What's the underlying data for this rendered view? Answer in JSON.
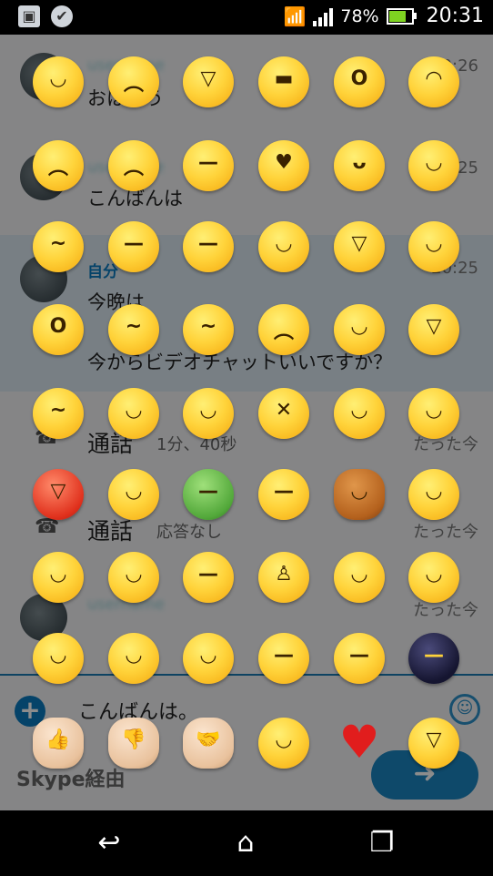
{
  "status_bar": {
    "battery_percent": "78%",
    "battery_level": 0.78,
    "time": "20:31",
    "icons": [
      "image-icon",
      "check-shield-icon",
      "wifi-icon",
      "signal-icon",
      "battery-icon"
    ]
  },
  "chat": {
    "messages": [
      {
        "sender": "",
        "time": "20:26",
        "text": "おはよう"
      },
      {
        "sender": "",
        "time": "20:25",
        "text": "こんばんは"
      },
      {
        "sender": "自分",
        "time": "20:25",
        "text": "今晩は",
        "text2": "今からビデオチャットいいですか？"
      }
    ],
    "calls": [
      {
        "title": "通話",
        "detail": "1分、40秒",
        "time": "たった今"
      },
      {
        "title": "通話",
        "detail": "応答なし",
        "time": "たった今"
      }
    ],
    "last_time": "たった今"
  },
  "input": {
    "text": "こんばんは。",
    "via": "Skype経由"
  },
  "emoticons": [
    [
      "smile",
      "sad",
      "laugh",
      "cool",
      "surprised",
      "wink"
    ],
    [
      "crying",
      "sweating",
      "speechless",
      "kiss",
      "tongue-out",
      "blush"
    ],
    [
      "wondering",
      "sleepy",
      "dull",
      "in-love",
      "evil-grin",
      "fingers-crossed"
    ],
    [
      "yawn",
      "puke",
      "doh",
      "angry",
      "wasntme",
      "party"
    ],
    [
      "worried",
      "mmm",
      "nerd",
      "lips-sealed",
      "hi",
      "facepalm"
    ],
    [
      "devil",
      "angel",
      "envy",
      "wait",
      "bear",
      "make-up"
    ],
    [
      "giggle",
      "clapping",
      "thinking",
      "bow",
      "rofl",
      "whew"
    ],
    [
      "happy",
      "smirk",
      "nod",
      "shake",
      "waiting",
      "emo"
    ],
    [
      "yes",
      "no",
      "handshake",
      "highfive",
      "heart",
      "hug"
    ]
  ],
  "colors": {
    "accent": "#0a7abf",
    "send_button": "#1a86c2",
    "highlight": "#dbe8f1"
  }
}
